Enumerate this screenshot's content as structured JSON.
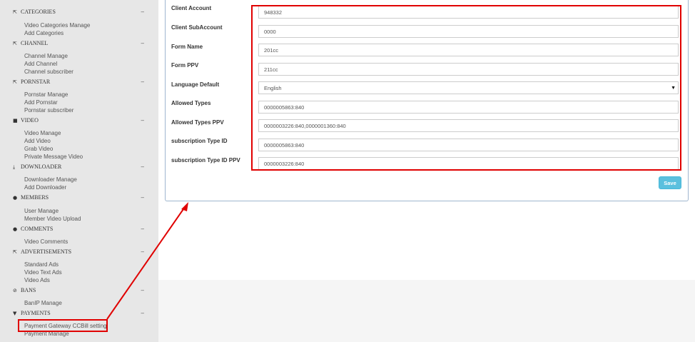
{
  "sidebar": {
    "categories": {
      "icon": "external-link-icon",
      "icon_glyph": "⇱",
      "title": "CATEGORIES",
      "collapse": "–",
      "items": [
        "Video Categories Manage",
        "Add Categories"
      ]
    },
    "channel": {
      "icon": "external-link-icon",
      "icon_glyph": "⇱",
      "title": "CHANNEL",
      "collapse": "–",
      "items": [
        "Channel Manage",
        "Add Channel",
        "Channel subscriber"
      ]
    },
    "pornstar": {
      "icon": "external-link-icon",
      "icon_glyph": "⇱",
      "title": "PORNSTAR",
      "collapse": "–",
      "items": [
        "Pornstar Manage",
        "Add Pornstar",
        "Pornstar subscriber"
      ]
    },
    "video": {
      "icon": "video-camera-icon",
      "icon_glyph": "■",
      "title": "VIDEO",
      "collapse": "–",
      "items": [
        "Video Manage",
        "Add Video",
        "Grab Video",
        "Private Message Video"
      ]
    },
    "downloader": {
      "icon": "download-icon",
      "icon_glyph": "⤓",
      "title": "DOWNLOADER",
      "collapse": "–",
      "items": [
        "Downloader Manage",
        "Add Downloader"
      ]
    },
    "members": {
      "icon": "users-icon",
      "icon_glyph": "●",
      "title": "MEMBERS",
      "collapse": "–",
      "items": [
        "User Manage",
        "Member Video Upload"
      ]
    },
    "comments": {
      "icon": "comments-icon",
      "icon_glyph": "●",
      "title": "COMMENTS",
      "collapse": "–",
      "items": [
        "Video Comments"
      ]
    },
    "advertisements": {
      "icon": "external-link-icon",
      "icon_glyph": "⇱",
      "title": "ADVERTISEMENTS",
      "collapse": "–",
      "items": [
        "Standard Ads",
        "Video Text Ads",
        "Video Ads"
      ]
    },
    "bans": {
      "icon": "ban-icon",
      "icon_glyph": "⊘",
      "title": "BANS",
      "collapse": "–",
      "items": [
        "BanIP Manage"
      ]
    },
    "payments": {
      "icon": "cart-icon",
      "icon_glyph": "▼",
      "title": "PAYMENTS",
      "collapse": "–",
      "items": [
        "Payment Gateway CCBill setting",
        "Payment Manage"
      ]
    }
  },
  "form": {
    "client_account": {
      "label": "Client Account",
      "value": "948332"
    },
    "client_subaccount": {
      "label": "Client SubAccount",
      "value": "0000"
    },
    "form_name": {
      "label": "Form Name",
      "value": "201cc"
    },
    "form_ppv": {
      "label": "Form PPV",
      "value": "211cc"
    },
    "language_default": {
      "label": "Language Default",
      "value": "English",
      "arrow": "▼"
    },
    "allowed_types": {
      "label": "Allowed Types",
      "value": "0000005863:840"
    },
    "allowed_types_ppv": {
      "label": "Allowed Types PPV",
      "value": "0000003226:840,0000001360:840"
    },
    "subscription_type_id": {
      "label": "subscription Type ID",
      "value": "0000005863:840"
    },
    "subscription_type_id_ppv": {
      "label": "subscription Type ID PPV",
      "value": "0000003226:840"
    },
    "save_label": "Save"
  },
  "colors": {
    "highlight": "#e00000",
    "accent": "#5bc0de",
    "sidebar_bg": "#e7e7e7"
  }
}
